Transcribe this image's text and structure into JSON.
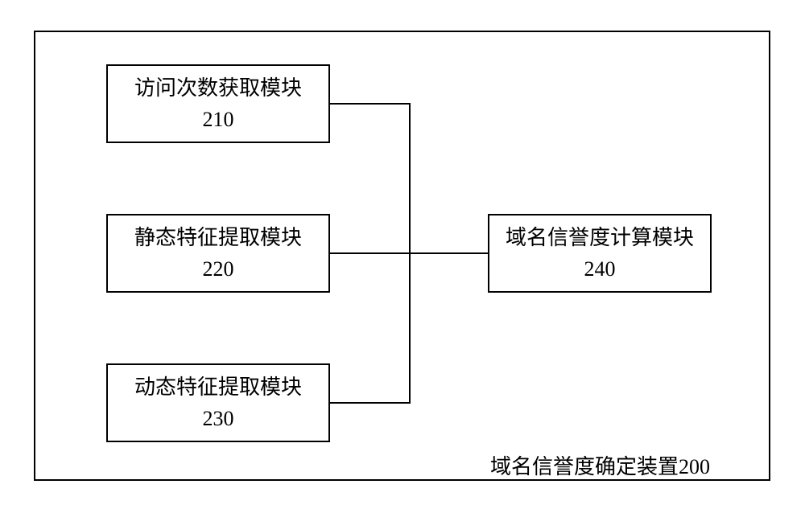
{
  "boxes": {
    "b210": {
      "label": "访问次数获取模块",
      "num": "210"
    },
    "b220": {
      "label": "静态特征提取模块",
      "num": "220"
    },
    "b230": {
      "label": "动态特征提取模块",
      "num": "230"
    },
    "b240": {
      "label": "域名信誉度计算模块",
      "num": "240"
    }
  },
  "caption": "域名信誉度确定装置200"
}
